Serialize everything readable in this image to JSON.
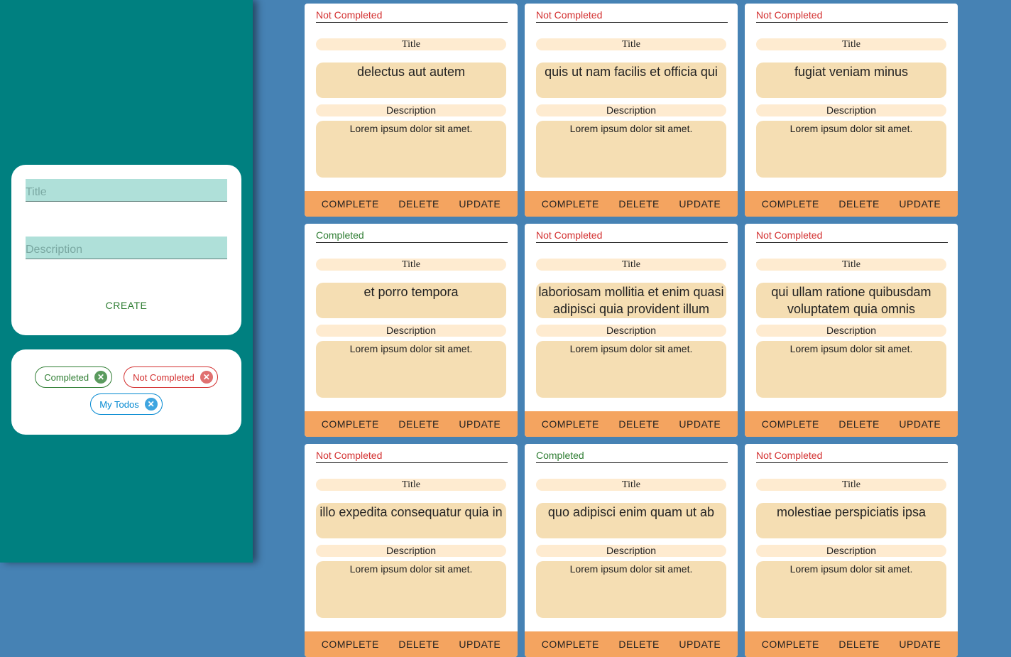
{
  "form": {
    "title_placeholder": "Title",
    "description_placeholder": "Description",
    "create_label": "CREATE"
  },
  "filters": [
    {
      "label": "Completed",
      "kind": "completed"
    },
    {
      "label": "Not Completed",
      "kind": "notcompleted"
    },
    {
      "label": "My Todos",
      "kind": "mytodos"
    }
  ],
  "labels": {
    "title": "Title",
    "description": "Description",
    "complete": "COMPLETE",
    "delete": "DELETE",
    "update": "UPDATE"
  },
  "todos": [
    {
      "status": "Not Completed",
      "title": "delectus aut autem",
      "description": "Lorem ipsum dolor sit amet."
    },
    {
      "status": "Not Completed",
      "title": "quis ut nam facilis et officia qui",
      "description": "Lorem ipsum dolor sit amet."
    },
    {
      "status": "Not Completed",
      "title": "fugiat veniam minus",
      "description": "Lorem ipsum dolor sit amet."
    },
    {
      "status": "Completed",
      "title": "et porro tempora",
      "description": "Lorem ipsum dolor sit amet."
    },
    {
      "status": "Not Completed",
      "title": "laboriosam mollitia et enim quasi adipisci quia provident illum",
      "description": "Lorem ipsum dolor sit amet."
    },
    {
      "status": "Not Completed",
      "title": "qui ullam ratione quibusdam voluptatem quia omnis",
      "description": "Lorem ipsum dolor sit amet."
    },
    {
      "status": "Not Completed",
      "title": "illo expedita consequatur quia in",
      "description": "Lorem ipsum dolor sit amet."
    },
    {
      "status": "Completed",
      "title": "quo adipisci enim quam ut ab",
      "description": "Lorem ipsum dolor sit amet."
    },
    {
      "status": "Not Completed",
      "title": "molestiae perspiciatis ipsa",
      "description": "Lorem ipsum dolor sit amet."
    }
  ],
  "colors": {
    "sidebar": "#008080",
    "main_bg": "#4682b4",
    "actions_bg": "#f4a460",
    "completed": "#2e7d32",
    "not_completed": "#d32f2f"
  }
}
